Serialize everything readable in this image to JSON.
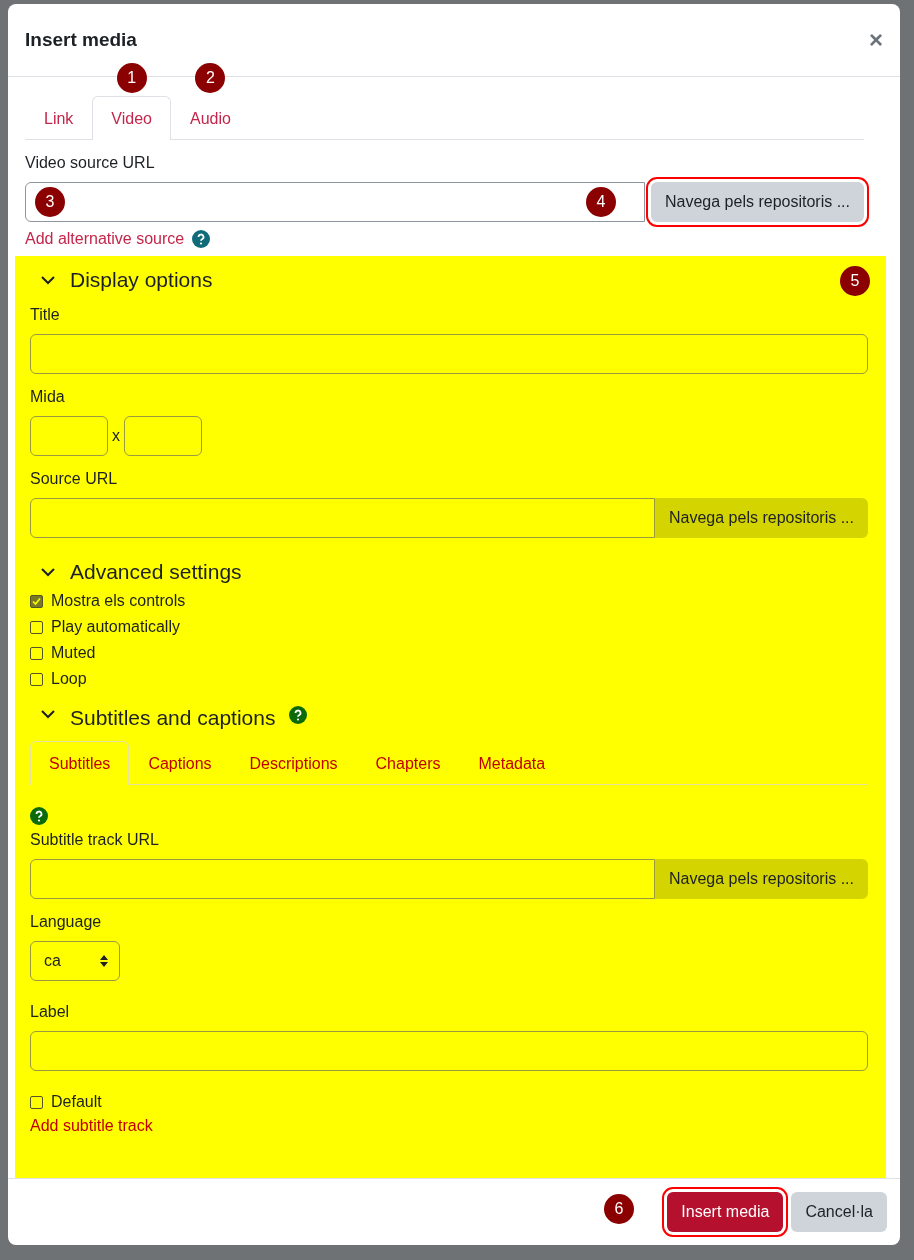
{
  "dialog": {
    "title": "Insert media",
    "close": "×"
  },
  "tabs": [
    {
      "label": "Link",
      "selected": false
    },
    {
      "label": "Video",
      "selected": true,
      "marker": "1"
    },
    {
      "label": "Audio",
      "selected": false,
      "marker": "2"
    }
  ],
  "source": {
    "label": "Video source URL",
    "marker": "3",
    "browse": {
      "label": "Navega pels repositoris ...",
      "marker": "4",
      "highlighted": true
    },
    "add_link": "Add alternative source"
  },
  "options": {
    "highlighted": true,
    "marker": "5",
    "display": {
      "heading": "Display options",
      "expanded": true,
      "title_label": "Title",
      "size_label": "Mida",
      "size_sep": "x",
      "source_label": "Source URL",
      "browse": "Navega pels repositoris ..."
    },
    "advanced": {
      "heading": "Advanced settings",
      "expanded": true,
      "checks": [
        {
          "label": "Mostra els controls",
          "checked": true
        },
        {
          "label": "Play automatically",
          "checked": false
        },
        {
          "label": "Muted",
          "checked": false
        },
        {
          "label": "Loop",
          "checked": false
        }
      ]
    },
    "subtitles": {
      "heading": "Subtitles and captions",
      "expanded": true,
      "tabs": [
        {
          "label": "Subtitles",
          "selected": true
        },
        {
          "label": "Captions",
          "selected": false
        },
        {
          "label": "Descriptions",
          "selected": false
        },
        {
          "label": "Chapters",
          "selected": false
        },
        {
          "label": "Metadata",
          "selected": false
        }
      ],
      "track_label": "Subtitle track URL",
      "browse": "Navega pels repositoris ...",
      "language_label": "Language",
      "language": "ca",
      "label_label": "Label",
      "default": {
        "label": "Default",
        "checked": false
      },
      "add_link": "Add subtitle track"
    }
  },
  "footer": {
    "marker": "6",
    "buttons": [
      {
        "label": "Insert media",
        "kind": "primary",
        "highlighted": true
      },
      {
        "label": "Cancel·la",
        "kind": "secondary",
        "highlighted": false
      }
    ]
  }
}
